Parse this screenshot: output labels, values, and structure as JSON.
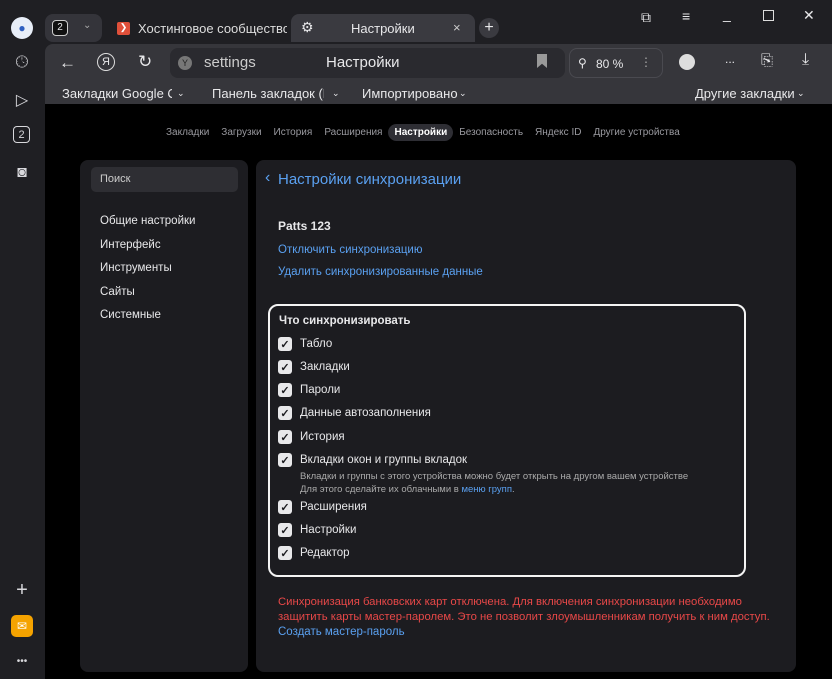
{
  "tabs": {
    "group_count": "2",
    "tab1": "Хостинговое сообщество",
    "tab2": "Настройки"
  },
  "toolbar": {
    "address": "settings",
    "page_title": "Настройки",
    "zoom": "80 %",
    "more": "..."
  },
  "bookmarks": {
    "items": [
      "Закладки Google Ch",
      "Панель закладок (Ed",
      "Импортировано"
    ],
    "other": "Другие закладки"
  },
  "sidebar": {
    "badge": "2"
  },
  "settings_nav": [
    "Закладки",
    "Загрузки",
    "История",
    "Расширения",
    "Настройки",
    "Безопасность",
    "Яндекс ID",
    "Другие устройства"
  ],
  "left": {
    "search": "Поиск",
    "items": [
      "Общие настройки",
      "Интерфейс",
      "Инструменты",
      "Сайты",
      "Системные"
    ]
  },
  "main": {
    "title": "Настройки синхронизации",
    "account": "Patts 123",
    "disable": "Отключить синхронизацию",
    "delete": "Удалить синхронизированные данные",
    "what": "Что синхронизировать",
    "items": [
      "Табло",
      "Закладки",
      "Пароли",
      "Данные автозаполнения",
      "История",
      "Вкладки окон и группы вкладок",
      "Расширения",
      "Настройки",
      "Редактор"
    ],
    "tabs_desc1": "Вкладки и группы с этого устройства можно будет открыть на другом вашем устройстве",
    "tabs_desc2": "Для этого сделайте их облачными в ",
    "tabs_link": "меню групп",
    "tabs_dot": ".",
    "warning": "Синхронизация банковских карт отключена. Для включения синхронизации необходимо защитить карты мастер-паролем. Это не позволит злоумышленникам получить к ним доступ.",
    "create_pw": "Создать мастер-пароль"
  }
}
